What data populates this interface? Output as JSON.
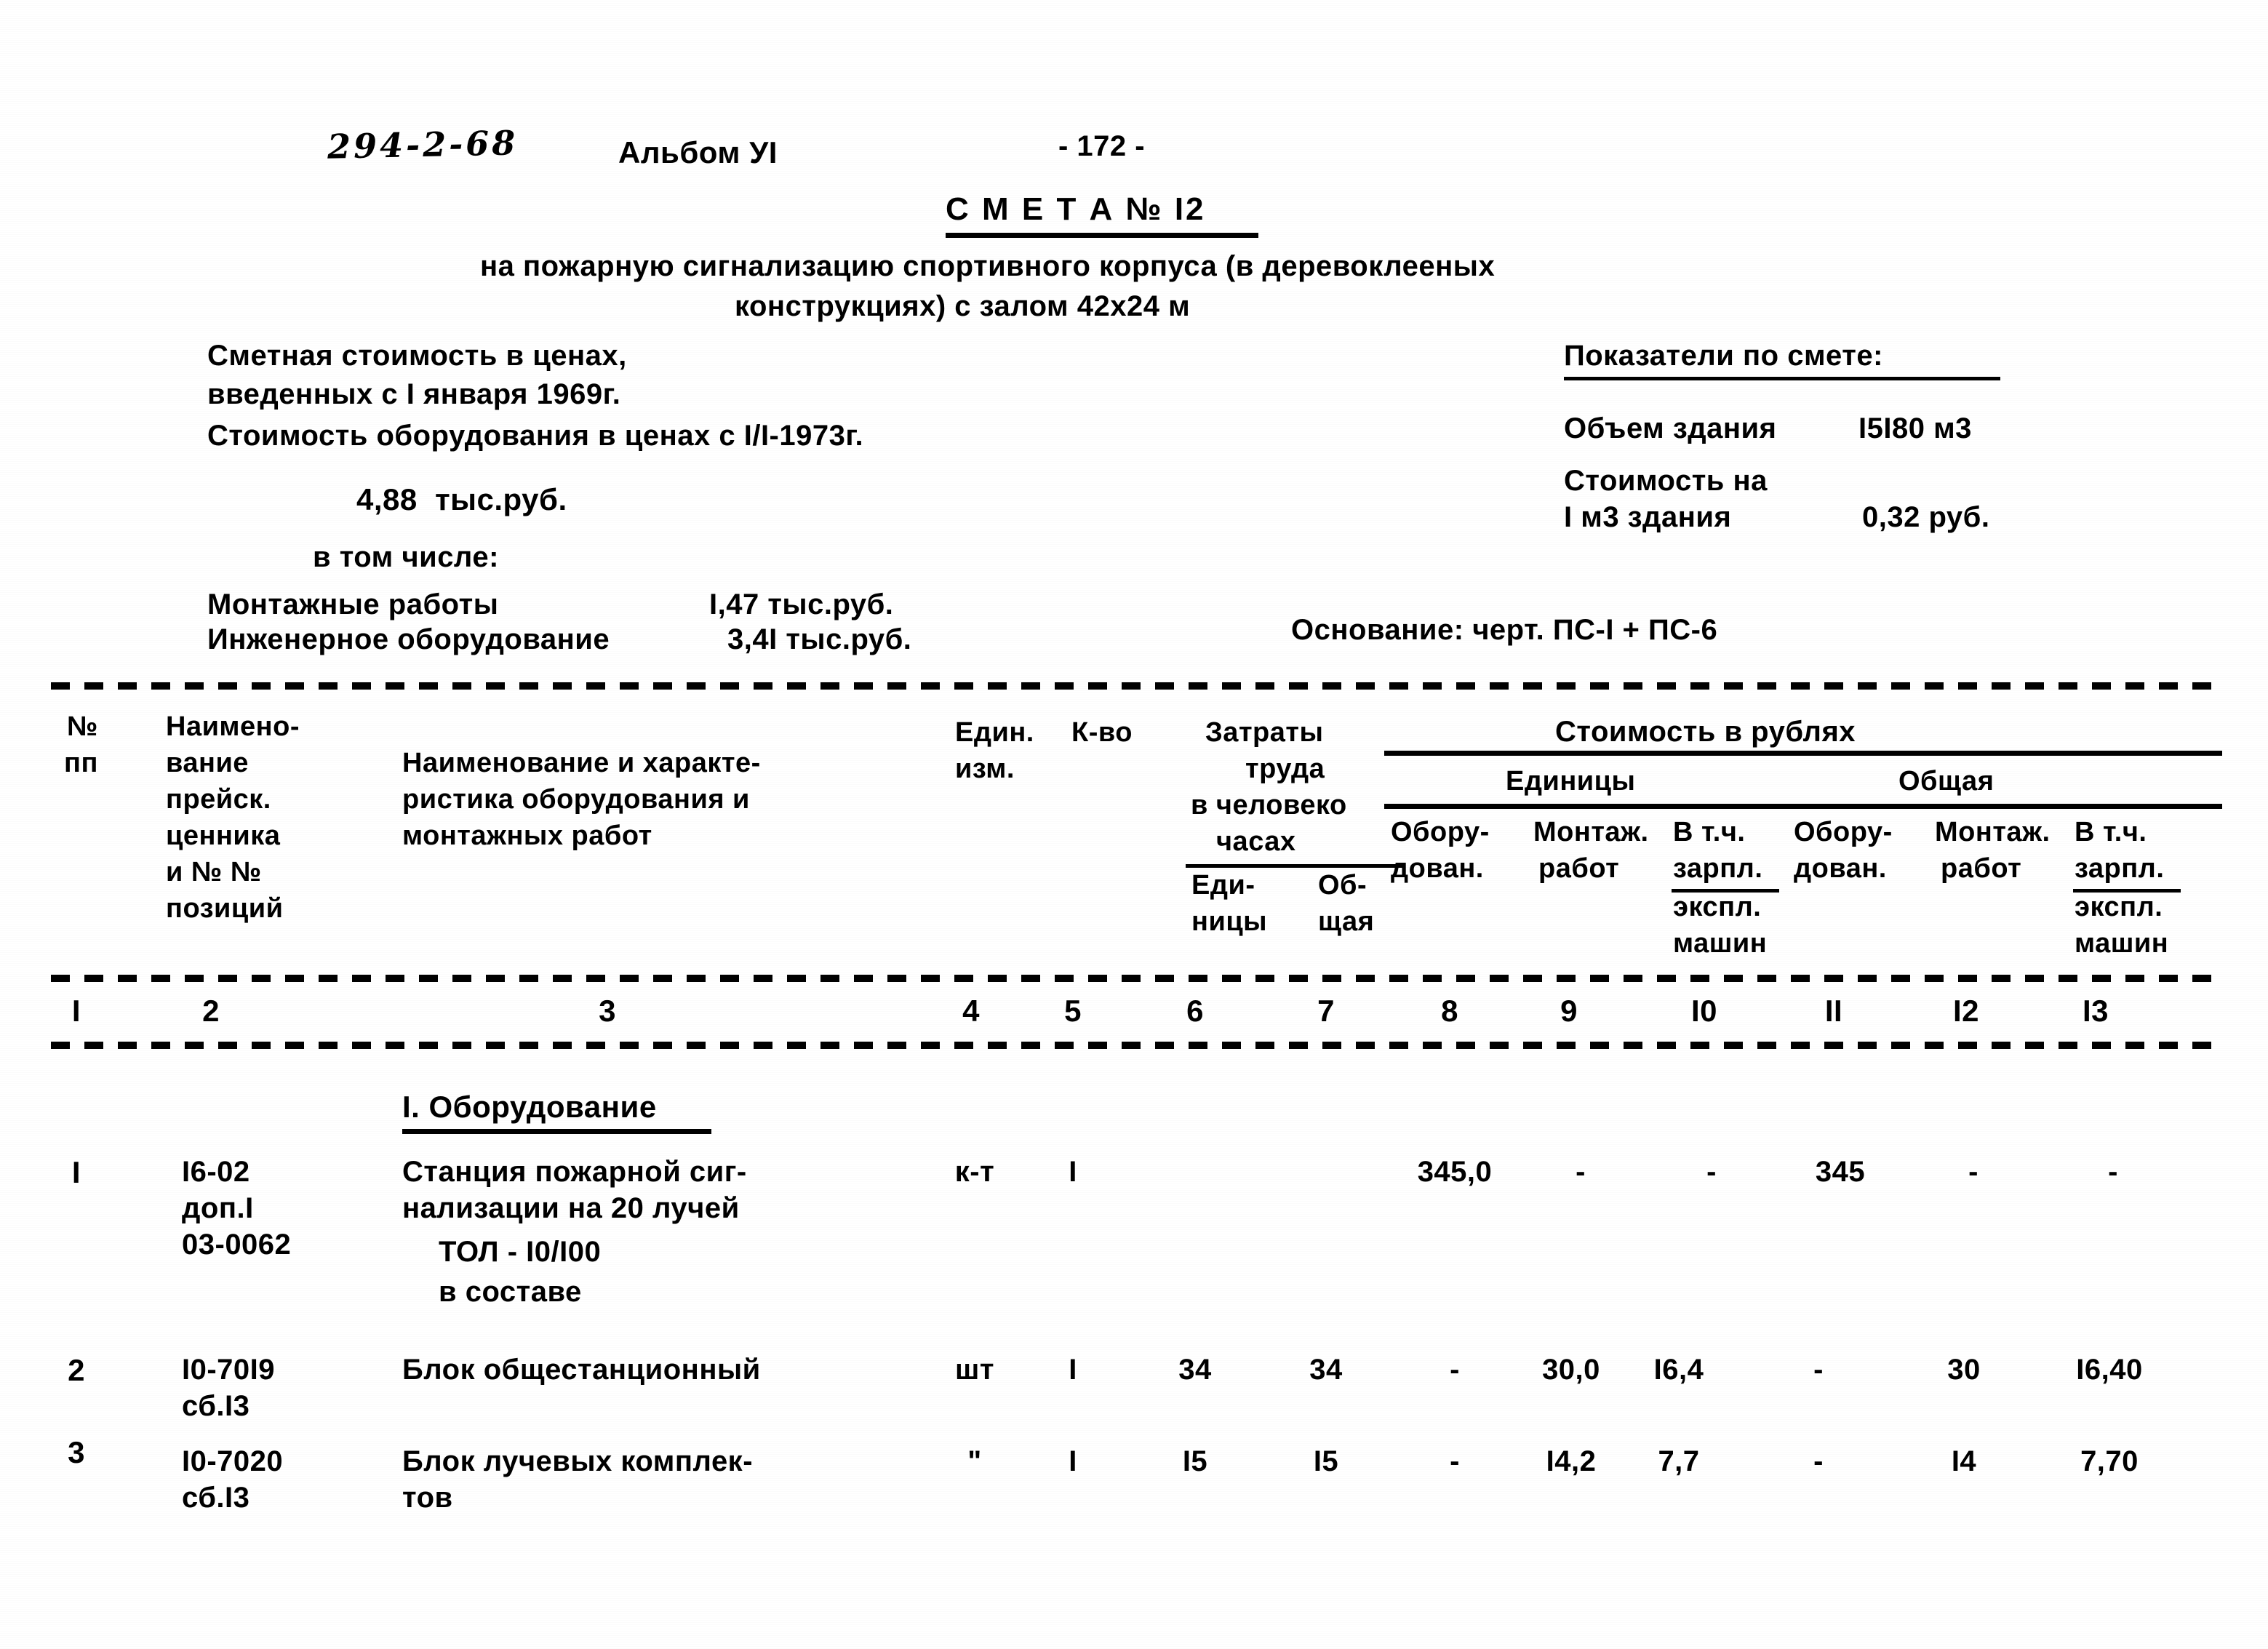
{
  "header": {
    "doc_code": "294-2-68",
    "album": "Альбом УI",
    "page_number": "- 172 -",
    "smeta_title": "С М Е Т А № I2",
    "subtitle_line1": "на пожарную сигнализацию спортивного корпуса (в деревоклееных",
    "subtitle_line2": "конструкциях) с залом 42х24 м"
  },
  "cost_block": {
    "line1": "Сметная стоимость в ценах,",
    "line2": "введенных с I января 1969г.",
    "line3": "Стоимость оборудования в ценах с I/I-1973г.",
    "total_value": "4,88  тыс.руб.",
    "including_label": "в том числе:",
    "item1_label": "Монтажные работы",
    "item1_value": "I,47 тыс.руб.",
    "item2_label": "Инженерное оборудование",
    "item2_value": "3,4I тыс.руб."
  },
  "indicators_block": {
    "title": "Показатели по смете:",
    "volume_label": "Объем здания",
    "volume_value": "I5I80 м3",
    "unit_cost_label_1": "Стоимость на",
    "unit_cost_label_2": "I м3 здания",
    "unit_cost_value": "0,32 руб.",
    "basis": "Основание: черт. ПС-I + ПС-6"
  },
  "table": {
    "head": {
      "col1_l1": "№",
      "col1_l2": "пп",
      "col2_l1": "Наимено-",
      "col2_l2": "вание",
      "col2_l3": "прейск.",
      "col2_l4": "ценника",
      "col2_l5": "и № №",
      "col2_l6": "позиций",
      "col3_l1": "Наименование и характе-",
      "col3_l2": "ристика оборудования и",
      "col3_l3": "монтажных работ",
      "col4_l1": "Един.",
      "col4_l2": "изм.",
      "col5": "К-во",
      "labor_l1": "Затраты",
      "labor_l2": "труда",
      "labor_l3": "в человеко",
      "labor_l4": "часах",
      "col6_l1": "Еди-",
      "col6_l2": "ницы",
      "col7_l1": "Об-",
      "col7_l2": "щая",
      "cost_title": "Стоимость в рублях",
      "unit_group": "Единицы",
      "total_group": "Общая",
      "col8_l1": "Обору-",
      "col8_l2": "дован.",
      "col9_l1": "Монтаж.",
      "col9_l2": "работ",
      "col10_l1": "В т.ч.",
      "col10_l2": "зарпл.",
      "col10_l3": "экспл.",
      "col10_l4": "машин",
      "col11_l1": "Обору-",
      "col11_l2": "дован.",
      "col12_l1": "Монтаж.",
      "col12_l2": "работ",
      "col13_l1": "В т.ч.",
      "col13_l2": "зарпл.",
      "col13_l3": "экспл.",
      "col13_l4": "машин"
    },
    "column_numbers": [
      "I",
      "2",
      "3",
      "4",
      "5",
      "6",
      "7",
      "8",
      "9",
      "I0",
      "II",
      "I2",
      "I3"
    ],
    "section_title": "I. Оборудование",
    "rows": [
      {
        "no": "I",
        "price_code_l1": "I6-02",
        "price_code_l2": "доп.I",
        "price_code_l3": "03-0062",
        "name_l1": "Станция пожарной сиг-",
        "name_l2": "нализации на 20 лучей",
        "name_l3": "ТОЛ - I0/I00",
        "name_l4": "в составе",
        "unit": "к-т",
        "qty": "I",
        "labor_unit": "",
        "labor_total": "",
        "c8": "345,0",
        "c9": "-",
        "c10": "-",
        "c11": "345",
        "c12": "-",
        "c13": "-"
      },
      {
        "no": "2",
        "price_code_l1": "I0-70I9",
        "price_code_l2": "сб.I3",
        "price_code_l3": "",
        "name_l1": "Блок общестанционный",
        "name_l2": "",
        "name_l3": "",
        "name_l4": "",
        "unit": "шт",
        "qty": "I",
        "labor_unit": "34",
        "labor_total": "34",
        "c8": "-",
        "c9": "30,0",
        "c10": "I6,4",
        "c11": "-",
        "c12": "30",
        "c13": "I6,40"
      },
      {
        "no": "3",
        "price_code_l1": "I0-7020",
        "price_code_l2": "сб.I3",
        "price_code_l3": "",
        "name_l1": "Блок лучевых комплек-",
        "name_l2": "тов",
        "name_l3": "",
        "name_l4": "",
        "unit": "\"",
        "qty": "I",
        "labor_unit": "I5",
        "labor_total": "I5",
        "c8": "-",
        "c9": "I4,2",
        "c10": "7,7",
        "c11": "-",
        "c12": "I4",
        "c13": "7,70"
      }
    ]
  }
}
